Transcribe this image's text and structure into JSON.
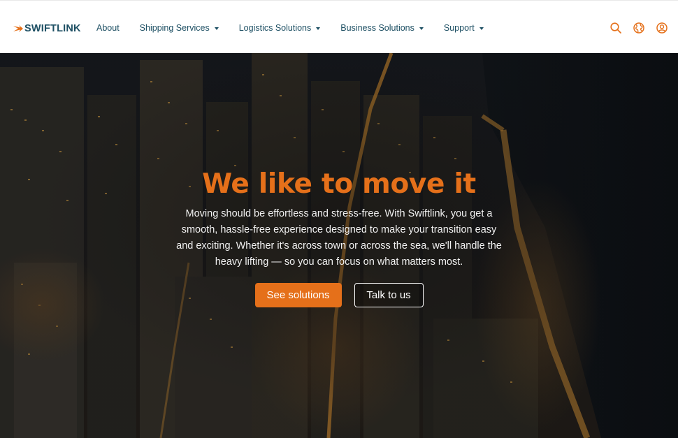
{
  "brand": {
    "name": "SWIFTLINK",
    "logo_icon": "swoosh-arrow-icon",
    "colors": {
      "accent": "#e5701a",
      "nav_text": "#1d4f63",
      "header_bg": "#ffffff"
    }
  },
  "nav": {
    "items": [
      {
        "label": "About",
        "has_dropdown": false
      },
      {
        "label": "Shipping Services",
        "has_dropdown": true
      },
      {
        "label": "Logistics Solutions",
        "has_dropdown": true
      },
      {
        "label": "Business Solutions",
        "has_dropdown": true
      },
      {
        "label": "Support",
        "has_dropdown": true
      }
    ]
  },
  "header_icons": [
    "search-icon",
    "globe-icon",
    "user-icon"
  ],
  "hero": {
    "title": "We like to move it",
    "text": "Moving should be effortless and stress-free. With Swiftlink, you get a smooth, hassle-free experience designed to make your transition easy and exciting. Whether it's across town or across the sea, we'll handle the heavy lifting — so you can focus on what matters most.",
    "primary_button": "See solutions",
    "secondary_button": "Talk to us",
    "background": "night-city-aerial-image"
  }
}
